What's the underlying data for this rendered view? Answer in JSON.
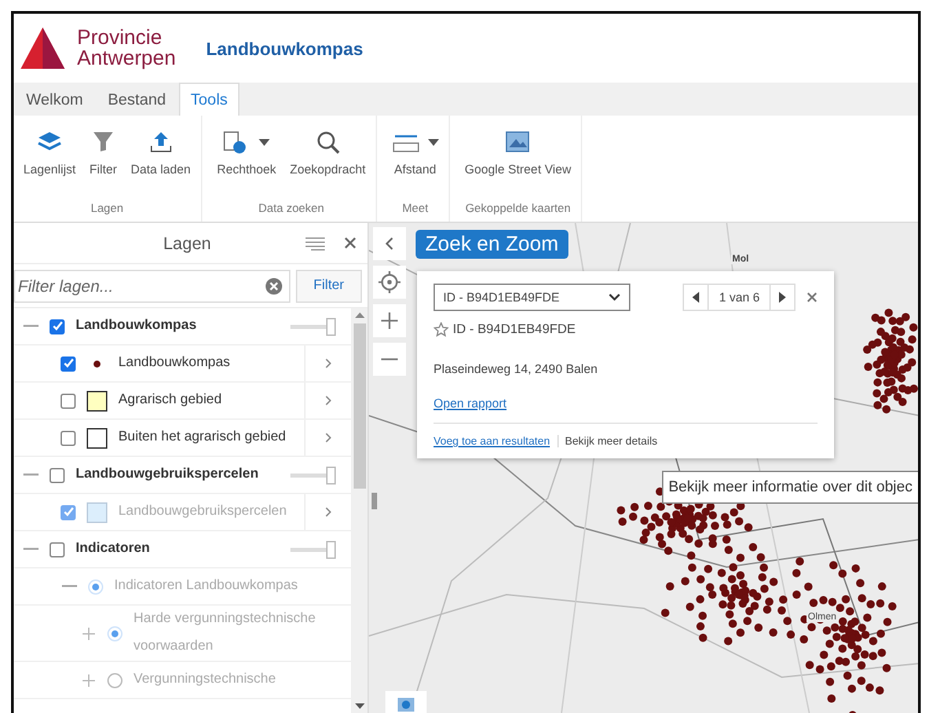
{
  "header": {
    "org_line1": "Provincie",
    "org_line2": "Antwerpen",
    "app_title": "Landbouwkompas"
  },
  "tabs": [
    {
      "label": "Welkom",
      "selected": false
    },
    {
      "label": "Bestand",
      "selected": false
    },
    {
      "label": "Tools",
      "selected": true
    }
  ],
  "ribbon": [
    {
      "group": "Lagen",
      "tools": [
        {
          "label": "Lagenlijst",
          "kind": "layers",
          "dropdown": false
        },
        {
          "label": "Filter",
          "kind": "filter",
          "dropdown": false
        },
        {
          "label": "Data laden",
          "kind": "upload",
          "dropdown": false
        }
      ]
    },
    {
      "group": "Data zoeken",
      "tools": [
        {
          "label": "Rechthoek",
          "kind": "rect",
          "dropdown": true
        },
        {
          "label": "Zoekopdracht",
          "kind": "query",
          "dropdown": false
        }
      ]
    },
    {
      "group": "Meet",
      "tools": [
        {
          "label": "Afstand",
          "kind": "measure",
          "dropdown": true
        }
      ]
    },
    {
      "group": "Gekoppelde kaarten",
      "tools": [
        {
          "label": "Google Street View",
          "kind": "streetview",
          "dropdown": false
        }
      ]
    }
  ],
  "layers_panel": {
    "title": "Lagen",
    "filter_placeholder": "Filter lagen...",
    "filter_button": "Filter",
    "items": [
      {
        "kind": "group",
        "label": "Landbouwkompas",
        "checked": true,
        "expanded": true,
        "level": 1,
        "children": [
          {
            "kind": "point_layer",
            "label": "Landbouwkompas",
            "checked": true,
            "disabled": false,
            "color": "#6b1010"
          },
          {
            "kind": "fill_layer",
            "label": "Agrarisch gebied",
            "checked": false,
            "disabled": false,
            "color": "#ffffc0"
          },
          {
            "kind": "fill_layer",
            "label": "Buiten het agrarisch gebied",
            "checked": false,
            "disabled": false,
            "color": "#ffffff"
          }
        ]
      },
      {
        "kind": "group",
        "label": "Landbouwgebruikspercelen",
        "checked": false,
        "expanded": true,
        "level": 1,
        "children": [
          {
            "kind": "fill_layer",
            "label": "Landbouwgebruikspercelen",
            "checked": true,
            "disabled": true,
            "color": "#dceefc"
          }
        ]
      },
      {
        "kind": "group",
        "label": "Indicatoren",
        "checked": false,
        "expanded": true,
        "level": 1,
        "children": [
          {
            "kind": "radio",
            "label": "Indicatoren Landbouwkompas",
            "selected": true,
            "expanded": true,
            "children": [
              {
                "kind": "radio",
                "label": "Harde vergunningstechnische voorwaarden",
                "selected": true,
                "expanded": false
              },
              {
                "kind": "radio",
                "label": "Vergunningstechnische",
                "selected": false,
                "expanded": false
              }
            ]
          }
        ]
      }
    ]
  },
  "map": {
    "search_badge": "Zoek en Zoom",
    "place_labels": [
      "Mol",
      "Olmen"
    ],
    "popup": {
      "feature_select": "ID - B94D1EB49FDE",
      "pager": "1 van 6",
      "title": "ID - B94D1EB49FDE",
      "address": "Plaseindeweg 14, 2490 Balen",
      "report_link": "Open rapport",
      "add_link": "Voeg toe aan resultaten",
      "details_link": "Bekijk meer details"
    },
    "tooltip": "Bekijk meer informatie over dit objec"
  }
}
